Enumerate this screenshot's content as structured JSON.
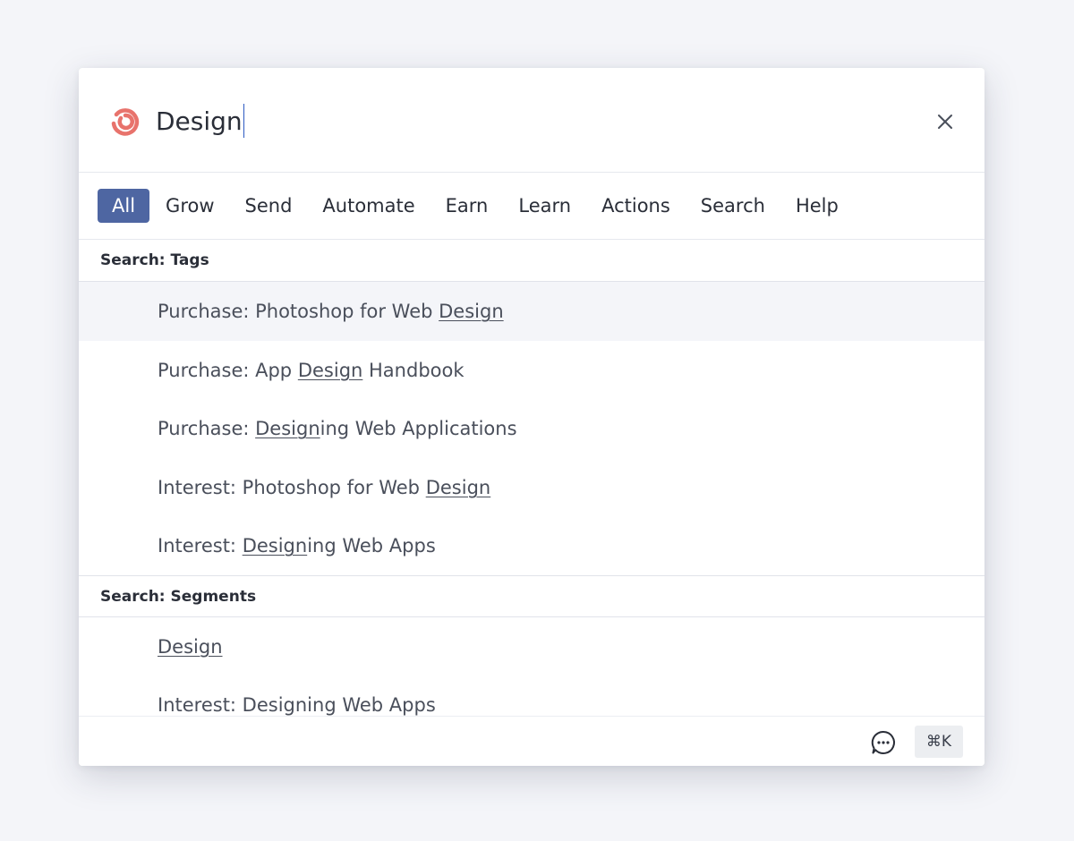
{
  "search": {
    "value": "Design",
    "query_highlight": "Design"
  },
  "tabs": [
    {
      "label": "All",
      "active": true
    },
    {
      "label": "Grow",
      "active": false
    },
    {
      "label": "Send",
      "active": false
    },
    {
      "label": "Automate",
      "active": false
    },
    {
      "label": "Earn",
      "active": false
    },
    {
      "label": "Learn",
      "active": false
    },
    {
      "label": "Actions",
      "active": false
    },
    {
      "label": "Search",
      "active": false
    },
    {
      "label": "Help",
      "active": false
    }
  ],
  "sections": [
    {
      "title": "Search: Tags",
      "items": [
        {
          "before": "Purchase: Photoshop for Web ",
          "match": "Design",
          "after": "",
          "highlighted": true
        },
        {
          "before": "Purchase: App ",
          "match": "Design",
          "after": " Handbook",
          "highlighted": false
        },
        {
          "before": "Purchase: ",
          "match": "Design",
          "after": "ing Web Applications",
          "highlighted": false
        },
        {
          "before": "Interest: Photoshop for Web ",
          "match": "Design",
          "after": "",
          "highlighted": false
        },
        {
          "before": "Interest: ",
          "match": "Design",
          "after": "ing Web Apps",
          "highlighted": false
        }
      ]
    },
    {
      "title": "Search: Segments",
      "items": [
        {
          "before": "",
          "match": "Design",
          "after": "",
          "highlighted": false
        },
        {
          "before": "Interest: Designing Web Apps",
          "match": "",
          "after": "",
          "highlighted": false
        }
      ]
    }
  ],
  "footer": {
    "chat_icon": "chat-bubble-icon",
    "shortcut_label": "⌘K"
  },
  "icons": {
    "logo": "convertkit-logo-icon",
    "close": "close-icon"
  },
  "colors": {
    "accent": "#4e66a2",
    "logo": "#e8736c",
    "highlight_row": "#f4f5f9"
  }
}
